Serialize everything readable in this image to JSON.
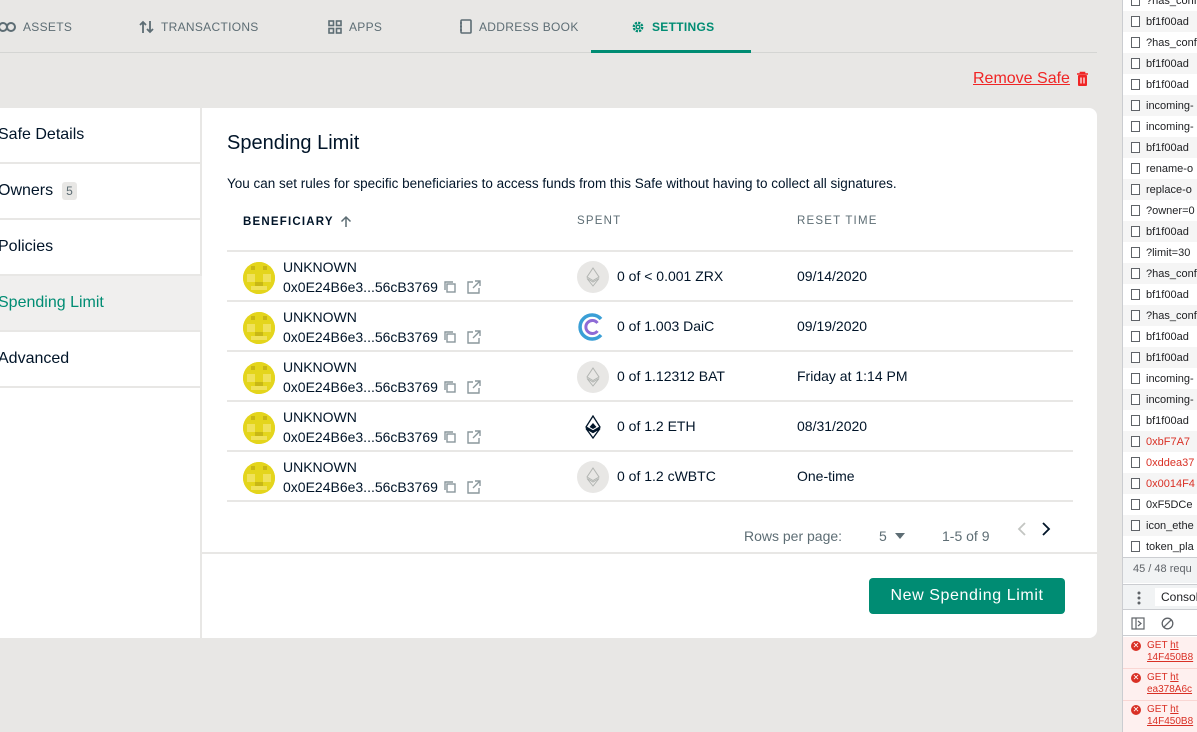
{
  "tabs": {
    "assets": "ASSETS",
    "transactions": "TRANSACTIONS",
    "apps": "APPS",
    "address_book": "ADDRESS BOOK",
    "settings": "SETTINGS"
  },
  "remove_safe": "Remove Safe",
  "sidebar": {
    "items": [
      {
        "label": "Safe Details"
      },
      {
        "label": "Owners",
        "badge": "5"
      },
      {
        "label": "Policies"
      },
      {
        "label": "Spending Limit"
      },
      {
        "label": "Advanced"
      }
    ]
  },
  "content": {
    "title": "Spending Limit",
    "description": "You can set rules for specific beneficiaries to access funds from this Safe without having to collect all signatures."
  },
  "table": {
    "headers": {
      "beneficiary": "BENEFICIARY",
      "spent": "SPENT",
      "reset_time": "RESET TIME"
    },
    "rows": [
      {
        "name": "UNKNOWN",
        "address": "0x0E24B6e3...56cB3769",
        "spent": "0 of < 0.001 ZRX",
        "reset": "09/14/2020",
        "token_icon": "ethereum-generic-icon"
      },
      {
        "name": "UNKNOWN",
        "address": "0x0E24B6e3...56cB3769",
        "spent": "0 of 1.003 DaiC",
        "reset": "09/19/2020",
        "token_icon": "daic-icon"
      },
      {
        "name": "UNKNOWN",
        "address": "0x0E24B6e3...56cB3769",
        "spent": "0 of 1.12312 BAT",
        "reset": "Friday at 1:14 PM",
        "token_icon": "ethereum-generic-icon"
      },
      {
        "name": "UNKNOWN",
        "address": "0x0E24B6e3...56cB3769",
        "spent": "0 of 1.2 ETH",
        "reset": "08/31/2020",
        "token_icon": "eth-icon"
      },
      {
        "name": "UNKNOWN",
        "address": "0x0E24B6e3...56cB3769",
        "spent": "0 of 1.2 cWBTC",
        "reset": "One-time",
        "token_icon": "ethereum-generic-icon"
      }
    ]
  },
  "pagination": {
    "rows_per_page_label": "Rows per page:",
    "rows_per_page_value": "5",
    "range": "1-5 of 9"
  },
  "new_button": "New Spending Limit",
  "devtools": {
    "requests": [
      "?has_conf",
      "bf1f00ad",
      "?has_conf",
      "bf1f00ad",
      "bf1f00ad",
      "incoming-",
      "incoming-",
      "bf1f00ad",
      "rename-o",
      "replace-o",
      "?owner=0",
      "bf1f00ad",
      "?limit=30",
      "?has_conf",
      "bf1f00ad",
      "?has_conf",
      "bf1f00ad",
      "bf1f00ad",
      "incoming-",
      "incoming-",
      "bf1f00ad",
      "0xbF7A7",
      "0xddea37",
      "0x0014F4",
      "0xF5DCe",
      "icon_ethe",
      "token_pla"
    ],
    "footer": "45 / 48 requ",
    "console_tab": "Consol",
    "errors": [
      {
        "method": "GET",
        "url": "ht",
        "line2": "14F450B8"
      },
      {
        "method": "GET",
        "url": "ht",
        "line2": "ea378A6c"
      },
      {
        "method": "GET",
        "url": "ht",
        "line2": "14F450B8"
      }
    ]
  }
}
